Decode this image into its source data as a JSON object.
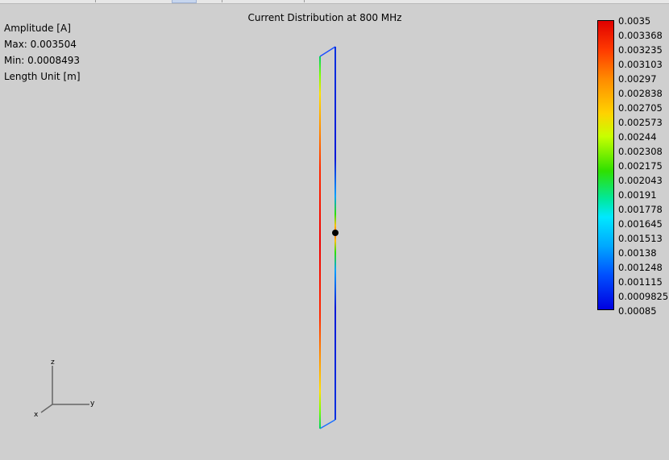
{
  "title": "Current Distribution at 800 MHz",
  "info": {
    "quantity": "Amplitude [A]",
    "max": "Max: 0.003504",
    "min": "Min: 0.0008493",
    "length_unit": "Length Unit [m]"
  },
  "legend": {
    "labels": [
      "0.0035",
      "0.003368",
      "0.003235",
      "0.003103",
      "0.00297",
      "0.002838",
      "0.002705",
      "0.002573",
      "0.00244",
      "0.002308",
      "0.002175",
      "0.002043",
      "0.00191",
      "0.001778",
      "0.001645",
      "0.001513",
      "0.00138",
      "0.001248",
      "0.001115",
      "0.0009825",
      "0.00085"
    ],
    "max_color": "#e00000",
    "min_color": "#0000e0"
  },
  "axes": {
    "z": "z",
    "y": "y",
    "x": "x"
  },
  "colors": {
    "background": "#cfcfcf",
    "feed_point": "#000000"
  }
}
